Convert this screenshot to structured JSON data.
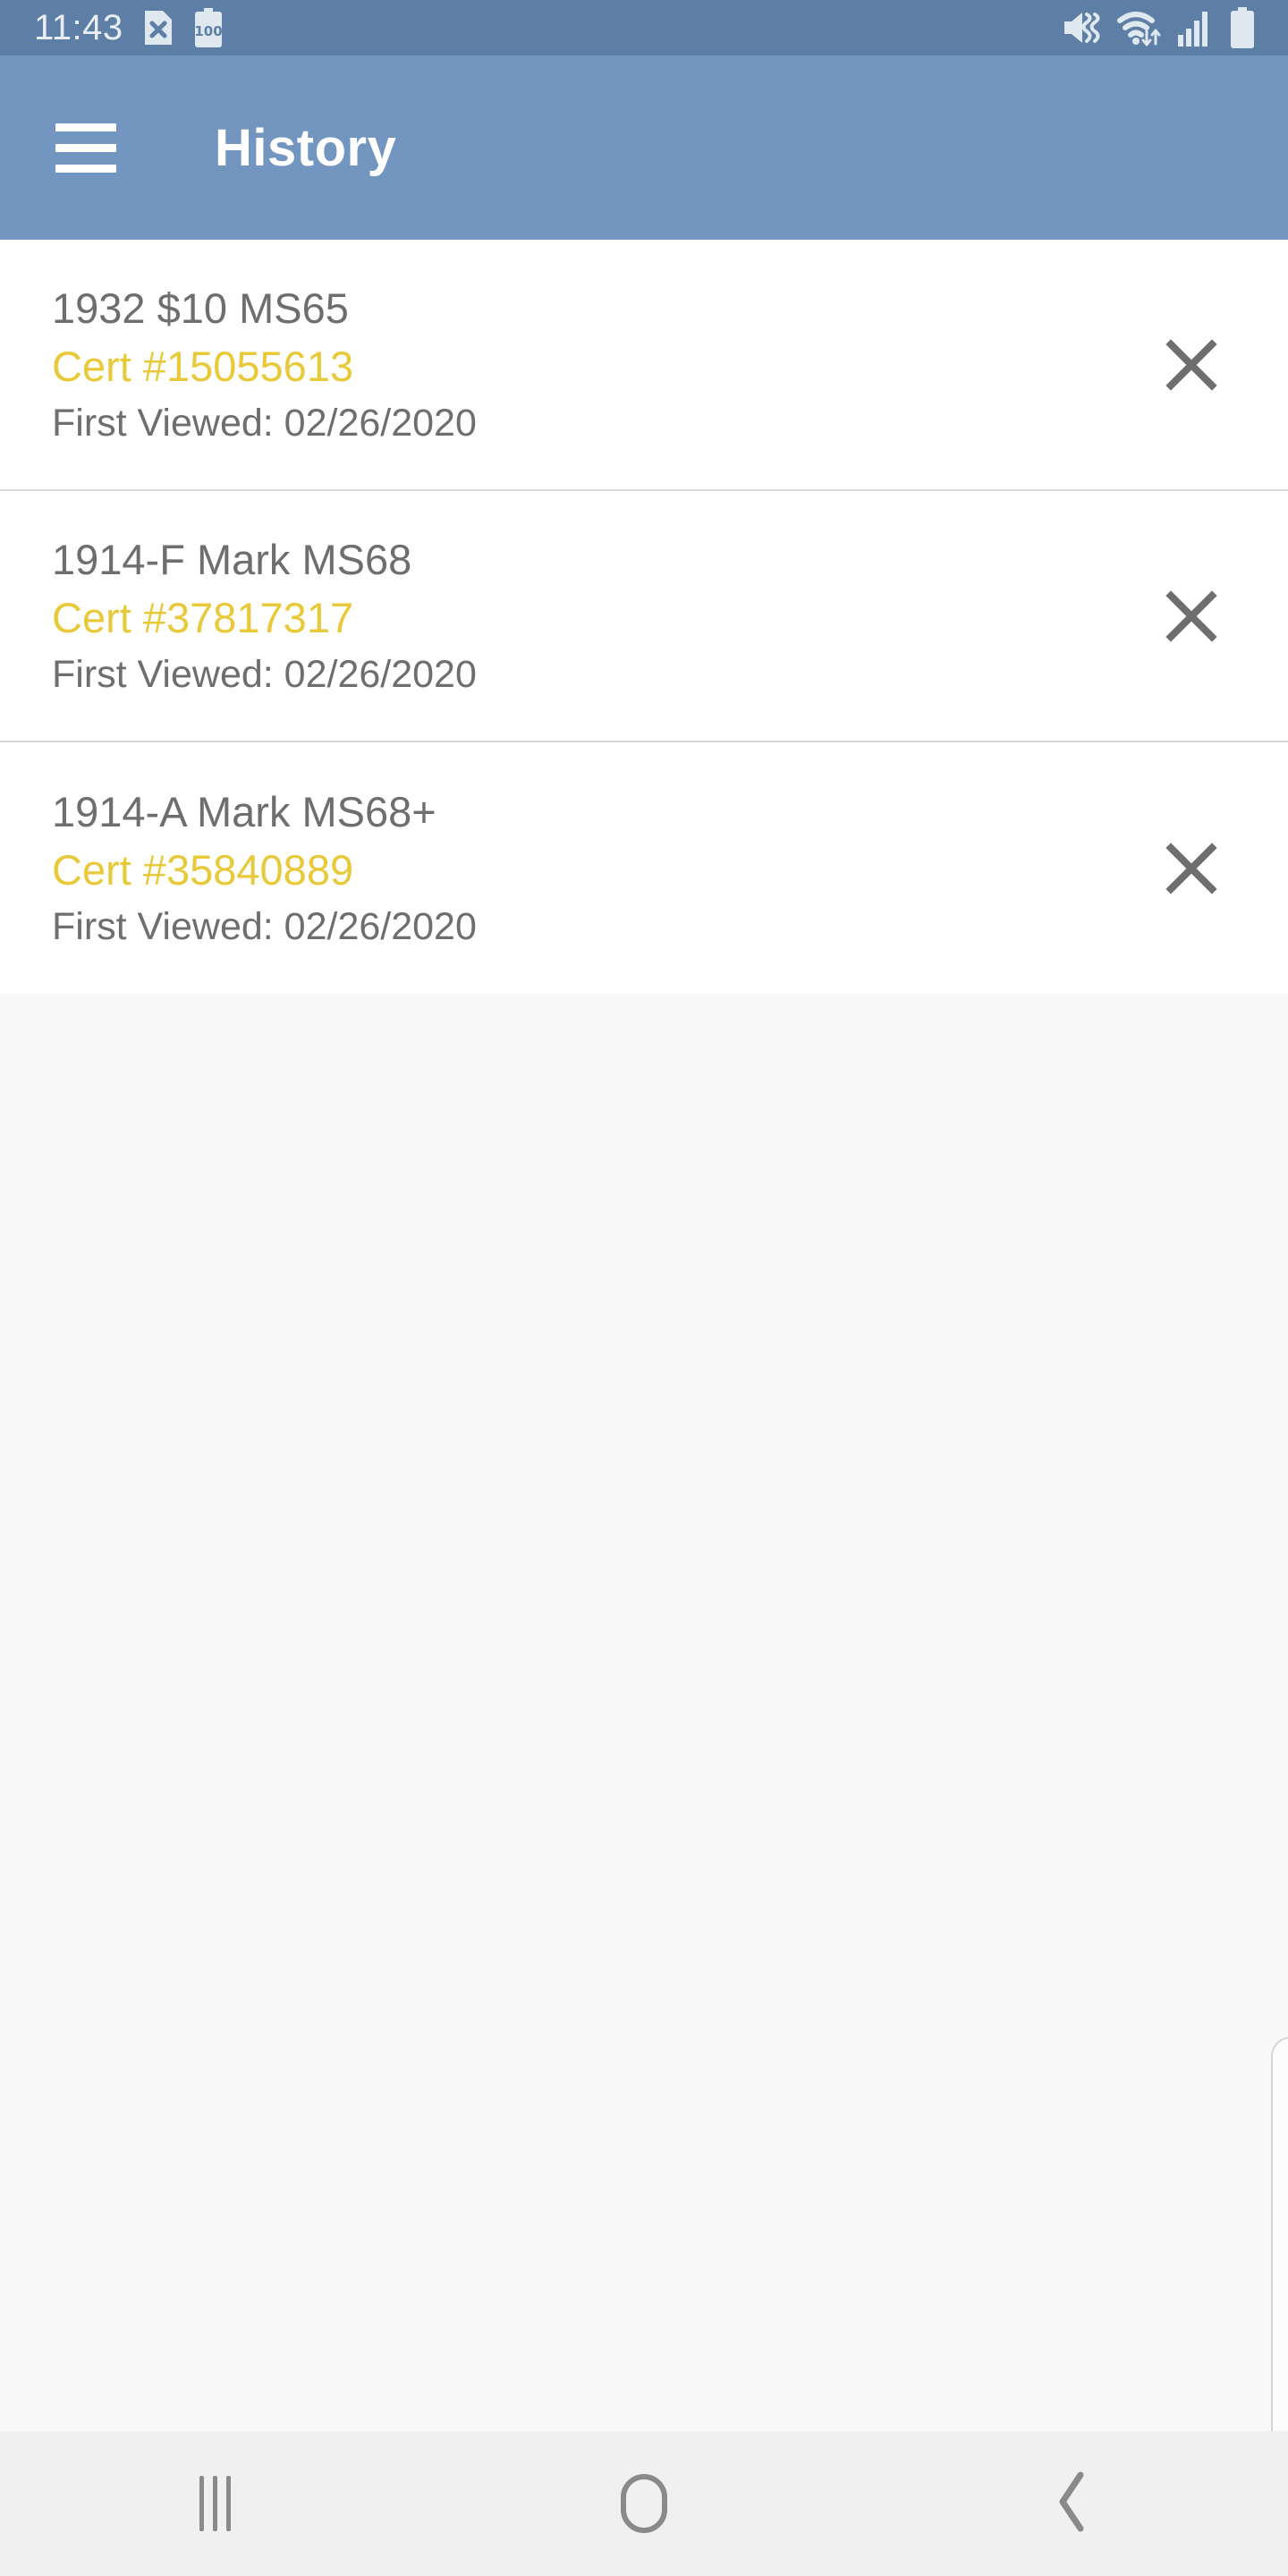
{
  "status_bar": {
    "time": "11:43",
    "icons_left": [
      "file-x-icon",
      "battery-level-icon"
    ],
    "battery_level_label": "100",
    "icons_right": [
      "mute-vibrate-icon",
      "wifi-icon",
      "cellular-signal-icon",
      "battery-icon"
    ],
    "background_color": "#5d7fa6"
  },
  "app_bar": {
    "menu_icon": "hamburger-menu-icon",
    "title": "History",
    "background_color": "#7296c0",
    "title_color": "#ffffff"
  },
  "list": {
    "items": [
      {
        "title": "1932 $10 MS65",
        "cert": "Cert #15055613",
        "first_viewed": "First Viewed: 02/26/2020",
        "close_icon": "close-x-icon"
      },
      {
        "title": "1914-F Mark MS68",
        "cert": "Cert #37817317",
        "first_viewed": "First Viewed: 02/26/2020",
        "close_icon": "close-x-icon"
      },
      {
        "title": "1914-A Mark MS68+",
        "cert": "Cert #35840889",
        "first_viewed": "First Viewed: 02/26/2020",
        "close_icon": "close-x-icon"
      }
    ],
    "cert_color": "#e8c93a",
    "text_color": "#6e6e6e",
    "background_color": "#ffffff"
  },
  "content": {
    "empty_background_color": "#f8f8f8"
  },
  "nav_bar": {
    "background_color": "#f0f0f0",
    "buttons": [
      {
        "name": "recents-button",
        "icon": "recents-icon"
      },
      {
        "name": "home-button",
        "icon": "home-icon"
      },
      {
        "name": "back-button",
        "icon": "back-chevron-icon"
      }
    ]
  }
}
